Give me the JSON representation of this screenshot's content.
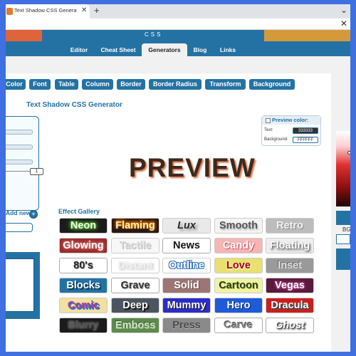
{
  "browser": {
    "tab_title": "Text Shadow CSS Generator Onli",
    "tab_close": "✕",
    "new_tab": "+",
    "corner_glyph": "✕"
  },
  "site": {
    "header_title": "CSS",
    "nav": [
      "Editor",
      "Cheat Sheet",
      "Generators",
      "Blog",
      "Links"
    ],
    "nav_active": "Generators"
  },
  "categories": [
    "Color",
    "Font",
    "Table",
    "Column",
    "Border",
    "Border Radius",
    "Transform",
    "Background"
  ],
  "generator": {
    "title": "Text Shadow CSS Generator",
    "range_value": "1",
    "add_new_label": "Add new",
    "add_icon": "+",
    "preview_text": "PREVIEW"
  },
  "preview_color": {
    "title": "Preview color:",
    "text_label": "Text:",
    "text_value": "333333",
    "text_color": "#333333",
    "background_label": "Background:",
    "background_value": "FFFFFF",
    "background_color": "#FFFFFF"
  },
  "gallery": {
    "title": "Effect Gallery",
    "effects": [
      [
        "Neon",
        "Flaming",
        "Lux",
        "Smooth",
        "Retro"
      ],
      [
        "Glowing",
        "Tactile",
        "News",
        "Candy",
        "Floating"
      ],
      [
        "80's",
        "Distant",
        "Outline",
        "Love",
        "Inset"
      ],
      [
        "Blocks",
        "Grave",
        "Solid",
        "Cartoon",
        "Vegas"
      ],
      [
        "Comic",
        "Deep",
        "Mummy",
        "Hero",
        "Dracula"
      ],
      [
        "Blurry",
        "Emboss",
        "Press",
        "Carve",
        "Ghost"
      ]
    ]
  },
  "right_panel": {
    "bg_label": "BG"
  },
  "colors": {
    "brand_blue": "#2472a4",
    "page_border": "#3f6fe0"
  }
}
